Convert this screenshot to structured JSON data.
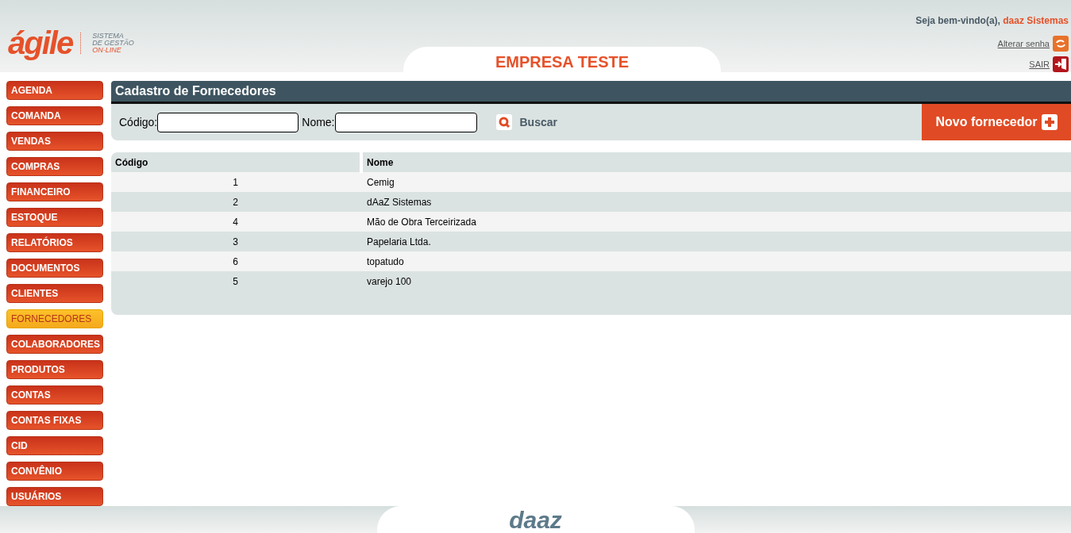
{
  "header": {
    "logo": "ágile",
    "tagline": [
      "SISTEMA",
      "DE GESTÃO",
      "ON-LINE"
    ],
    "company": "EMPRESA TESTE",
    "welcome": "Seja bem-vindo(a),",
    "user": "daaz Sistemas",
    "links": [
      {
        "kind": "password",
        "label": "Alterar senha"
      },
      {
        "kind": "exit",
        "label": "SAIR"
      }
    ]
  },
  "sidebar": {
    "items": [
      {
        "label": "AGENDA",
        "selected": false
      },
      {
        "label": "COMANDA",
        "selected": false
      },
      {
        "label": "VENDAS",
        "selected": false
      },
      {
        "label": "COMPRAS",
        "selected": false
      },
      {
        "label": "FINANCEIRO",
        "selected": false
      },
      {
        "label": "ESTOQUE",
        "selected": false
      },
      {
        "label": "RELATÓRIOS",
        "selected": false
      },
      {
        "label": "DOCUMENTOS",
        "selected": false
      },
      {
        "label": "CLIENTES",
        "selected": false
      },
      {
        "label": "FORNECEDORES",
        "selected": true
      },
      {
        "label": "COLABORADORES",
        "selected": false
      },
      {
        "label": "PRODUTOS",
        "selected": false
      },
      {
        "label": "CONTAS",
        "selected": false
      },
      {
        "label": "CONTAS FIXAS",
        "selected": false
      },
      {
        "label": "CID",
        "selected": false
      },
      {
        "label": "CONVÊNIO",
        "selected": false
      },
      {
        "label": "USUÁRIOS",
        "selected": false
      }
    ]
  },
  "panel": {
    "title": "Cadastro de Fornecedores",
    "filters": [
      {
        "label": "Código:"
      },
      {
        "label": "Nome:"
      }
    ],
    "search": "Buscar",
    "new_button": "Novo fornecedor"
  },
  "table": {
    "columns": [
      "Código",
      "Nome"
    ],
    "rows": [
      [
        "1",
        "Cemig"
      ],
      [
        "2",
        "dAaZ Sistemas"
      ],
      [
        "4",
        "Mão de Obra Terceirizada"
      ],
      [
        "3",
        "Papelaria Ltda."
      ],
      [
        "6",
        "topatudo"
      ],
      [
        "5",
        "varejo 100"
      ]
    ]
  },
  "footer": {
    "logo": "daaz"
  }
}
